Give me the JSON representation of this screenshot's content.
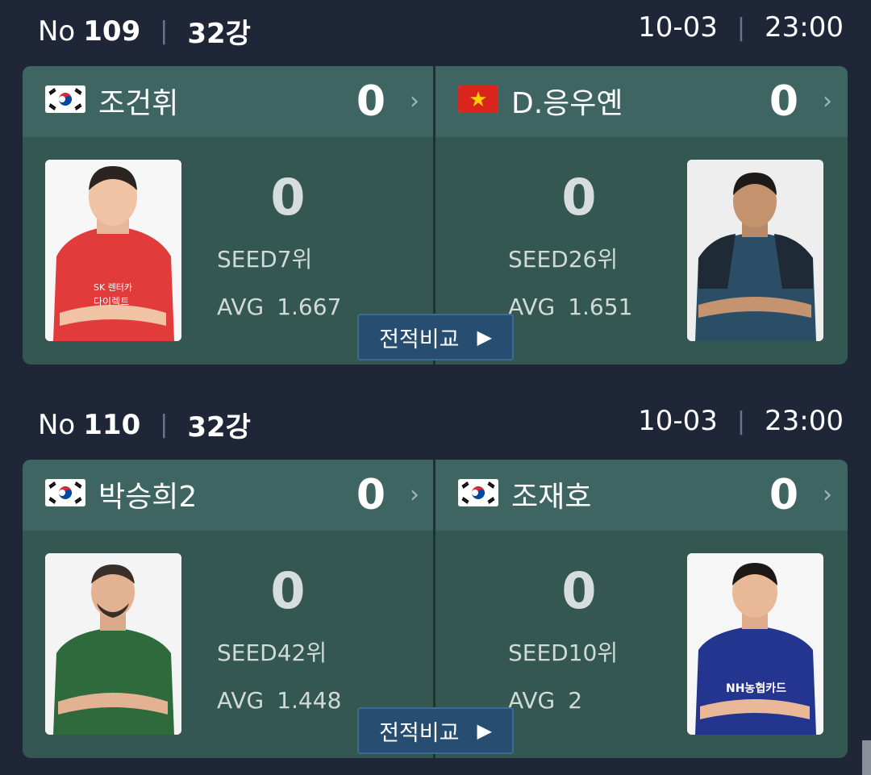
{
  "matches": [
    {
      "no_label": "No",
      "no": "109",
      "round": "32강",
      "date": "10-03",
      "time": "23:00",
      "left": {
        "flag": "korea",
        "name": "조건휘",
        "score": "0",
        "big_score": "0",
        "seed": "SEED7위",
        "avg_label": "AVG",
        "avg": "1.667"
      },
      "right": {
        "flag": "vietnam",
        "name": "D.응우옌",
        "score": "0",
        "big_score": "0",
        "seed": "SEED26위",
        "avg_label": "AVG",
        "avg": "1.651"
      },
      "compare_label": "전적비교"
    },
    {
      "no_label": "No",
      "no": "110",
      "round": "32강",
      "date": "10-03",
      "time": "23:00",
      "left": {
        "flag": "korea",
        "name": "박승희2",
        "score": "0",
        "big_score": "0",
        "seed": "SEED42위",
        "avg_label": "AVG",
        "avg": "1.448"
      },
      "right": {
        "flag": "korea",
        "name": "조재호",
        "score": "0",
        "big_score": "0",
        "seed": "SEED10위",
        "avg_label": "AVG",
        "avg": "2"
      },
      "compare_label": "전적비교"
    }
  ],
  "icons": {
    "chevron": "chevron-right-icon",
    "play": "play-triangle-icon"
  },
  "colors": {
    "background": "#1f2638",
    "card": "#355752",
    "card_header": "#3e6561",
    "compare_button": "#274e70"
  }
}
